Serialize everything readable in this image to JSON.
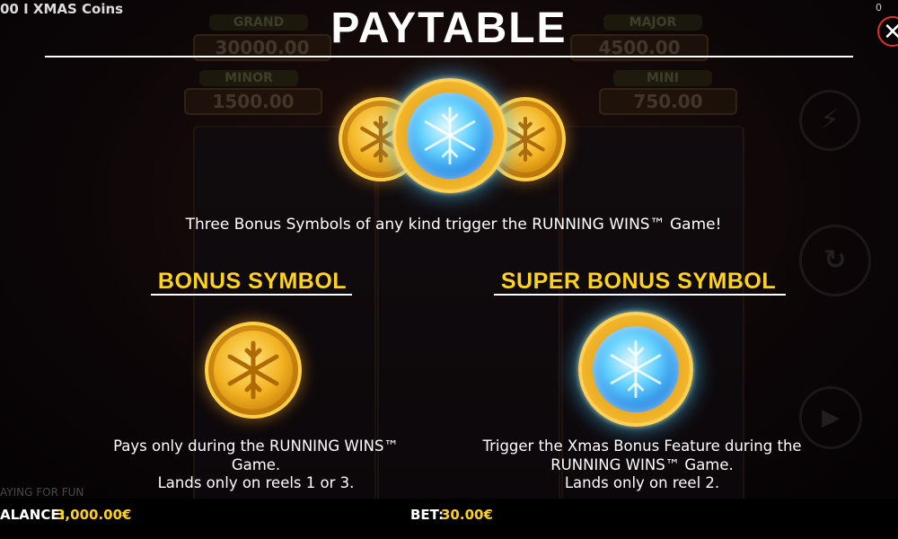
{
  "game": {
    "window_title": "00 I XMAS Coins",
    "counter": "0",
    "fun_mode_text": "AYING FOR FUN"
  },
  "jackpots": {
    "grand_label": "GRAND",
    "grand_value": "30000.00",
    "major_label": "MAJOR",
    "major_value": "4500.00",
    "minor_label": "MINOR",
    "minor_value": "1500.00",
    "mini_label": "MINI",
    "mini_value": "750.00"
  },
  "paytable": {
    "title": "PAYTABLE",
    "close_label": "✕",
    "trigger_text": "Three Bonus Symbols of any kind trigger the RUNNING WINS™ Game!",
    "bonus": {
      "title": "BONUS SYMBOL",
      "line1": "Pays only during the RUNNING WINS™",
      "line2": "Game.",
      "line3": "Lands only on reels 1 or 3."
    },
    "super_bonus": {
      "title": "SUPER BONUS SYMBOL",
      "line1": "Trigger the Xmas Bonus Feature during the",
      "line2": "RUNNING WINS™ Game.",
      "line3": "Lands only on reel 2."
    }
  },
  "footer": {
    "balance_label": "ALANCE:",
    "balance_value": "3,000.00€",
    "bet_label": "BET:",
    "bet_value": "30.00€"
  },
  "colors": {
    "accent_yellow": "#ffd21f",
    "close_red": "#e03030",
    "coin_gold": "#f3b423",
    "ice_blue": "#68d3ff"
  },
  "icons": {
    "close": "close-icon",
    "gold_coin": "snowflake-gold-coin-icon",
    "ice_coin": "snowflake-ice-coin-icon"
  }
}
